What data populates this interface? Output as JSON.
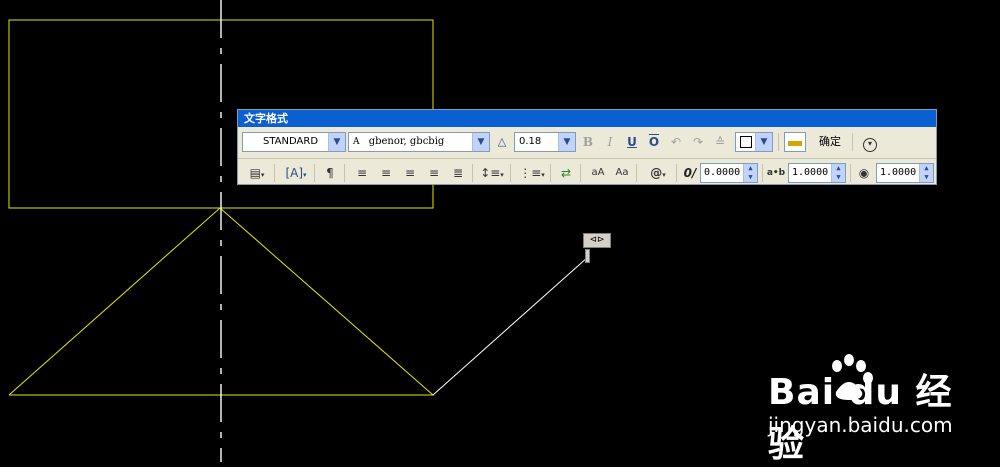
{
  "toolbar": {
    "title": "文字格式",
    "style": "STANDARD",
    "font": "gbenor, gbcbig",
    "text_height": "0.18",
    "bold": "B",
    "italic": "I",
    "underline": "U",
    "overline": "O",
    "color_swatch": "",
    "ok_label": "确定",
    "oblique_value": "0.0000",
    "tracking_value": "1.0000",
    "width_value": "1.0000",
    "tracking_icon_label": "a•b",
    "at_label": "@",
    "oblique_icon_label": "0/"
  },
  "grip": {
    "label": "⊲⊳"
  },
  "watermark": {
    "logo": "Bai  du 经验",
    "url": "jingyan.baidu.com"
  },
  "colors": {
    "drawing_line": "#ffff00",
    "titlebar": "#0a5fd1",
    "toolbar_bg": "#ece9d8"
  }
}
